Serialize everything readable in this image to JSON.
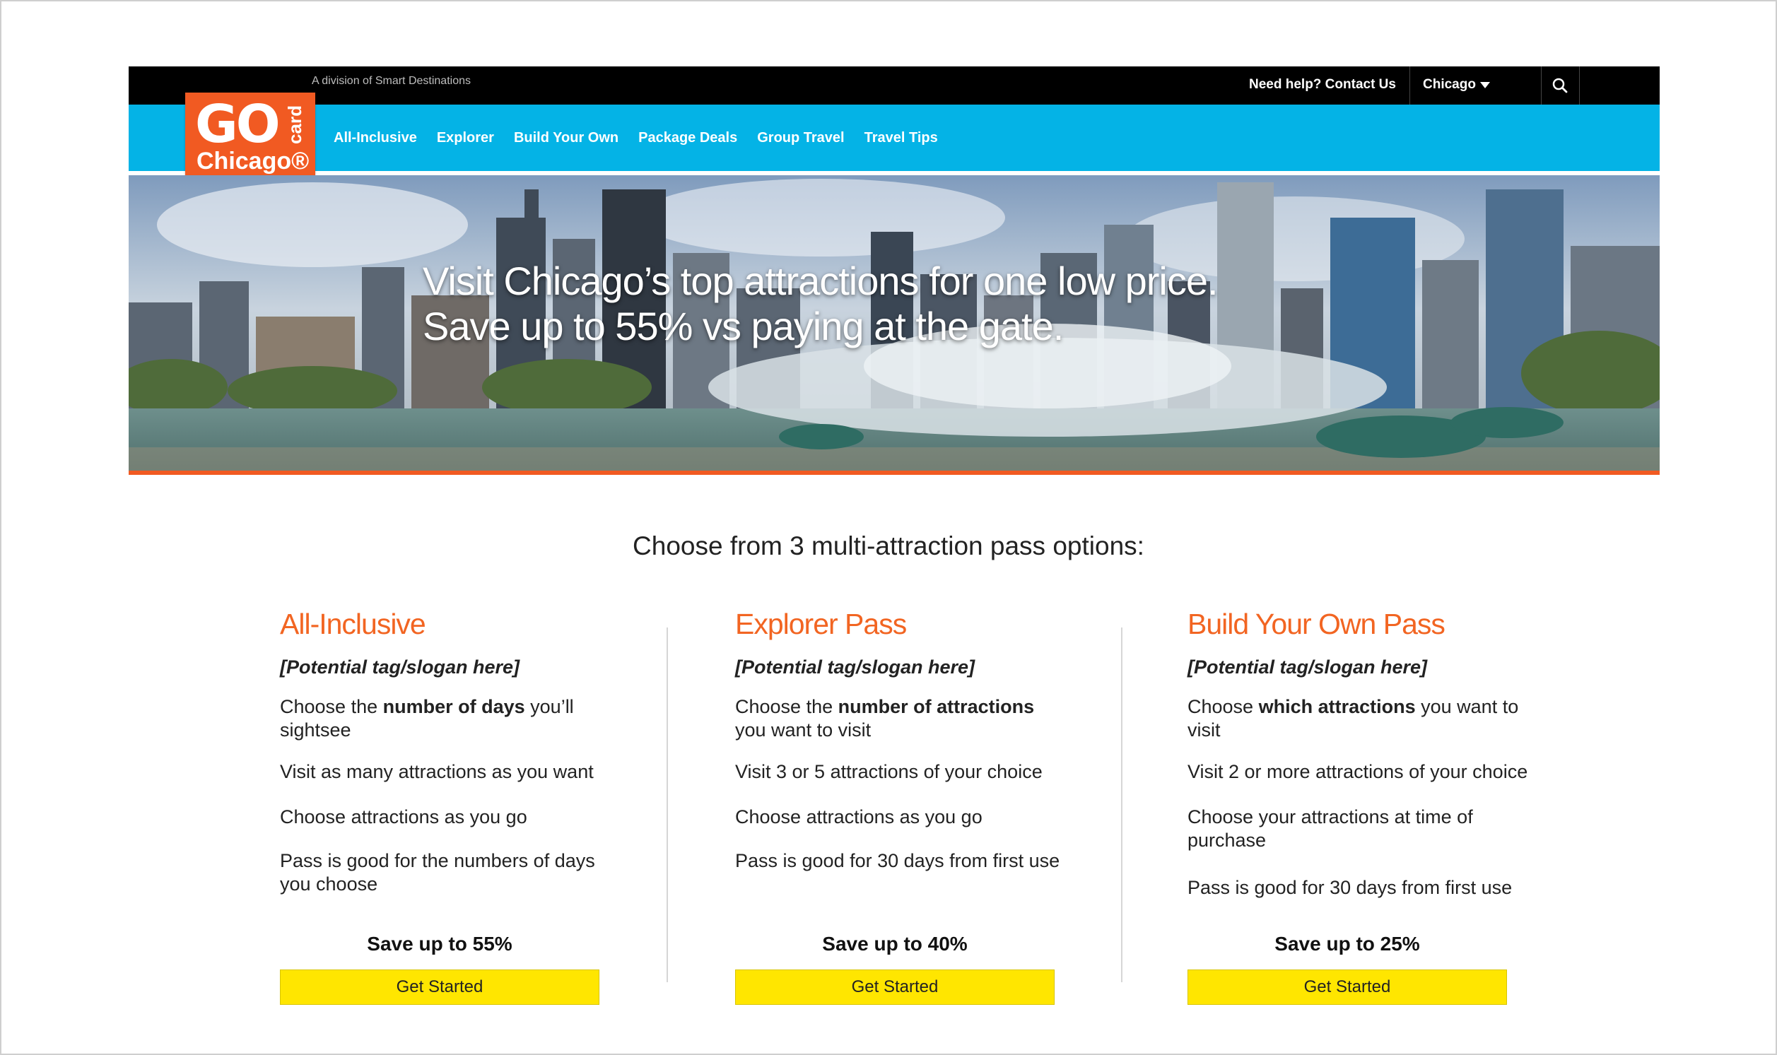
{
  "header": {
    "division": "A division of Smart Destinations",
    "help_link": "Need help? Contact Us",
    "city": "Chicago",
    "search_icon": "search-icon"
  },
  "logo": {
    "go": "GO",
    "card": "card",
    "city": "Chicago®"
  },
  "nav": {
    "items": [
      {
        "label": "All-Inclusive"
      },
      {
        "label": "Explorer"
      },
      {
        "label": "Build Your Own"
      },
      {
        "label": "Package Deals"
      },
      {
        "label": "Group Travel"
      },
      {
        "label": "Travel Tips"
      }
    ]
  },
  "hero": {
    "line1": "Visit Chicago’s top attractions for one low price.",
    "line2": "Save up to 55% vs paying at the gate."
  },
  "main": {
    "section_title": "Choose from 3 multi-attraction pass options:",
    "passes": [
      {
        "title": "All-Inclusive",
        "tag": "[Potential tag/slogan here]",
        "feature1": {
          "pre": "Choose the ",
          "bold": "number of days",
          "post": " you’ll sightsee"
        },
        "feature2": "Visit as many attractions as you want",
        "feature3": "Choose attractions as you go",
        "feature4": "Pass is good for the numbers of days you choose",
        "save": "Save up to 55%",
        "button": "Get Started"
      },
      {
        "title": "Explorer Pass",
        "tag": "[Potential tag/slogan here]",
        "feature1": {
          "pre": "Choose the ",
          "bold": "number of attractions",
          "post": " you want to visit"
        },
        "feature2": "Visit 3 or 5 attractions of your choice",
        "feature3": "Choose attractions as you go",
        "feature4": "Pass is good for 30 days from first use",
        "save": "Save up to 40%",
        "button": "Get Started"
      },
      {
        "title": "Build Your Own Pass",
        "tag": "[Potential tag/slogan here]",
        "feature1": {
          "pre": "Choose ",
          "bold": "which attractions",
          "post": " you want to visit"
        },
        "feature2": "Visit 2 or more attractions of your choice",
        "feature3": "Choose your attractions at time of purchase",
        "feature4": "Pass is good for 30 days from first use",
        "save": "Save up to 25%",
        "button": "Get Started"
      }
    ]
  },
  "colors": {
    "brand_orange": "#f15a22",
    "nav_blue": "#04b3e6",
    "cta_yellow": "#ffe600",
    "topbar_black": "#000000"
  }
}
